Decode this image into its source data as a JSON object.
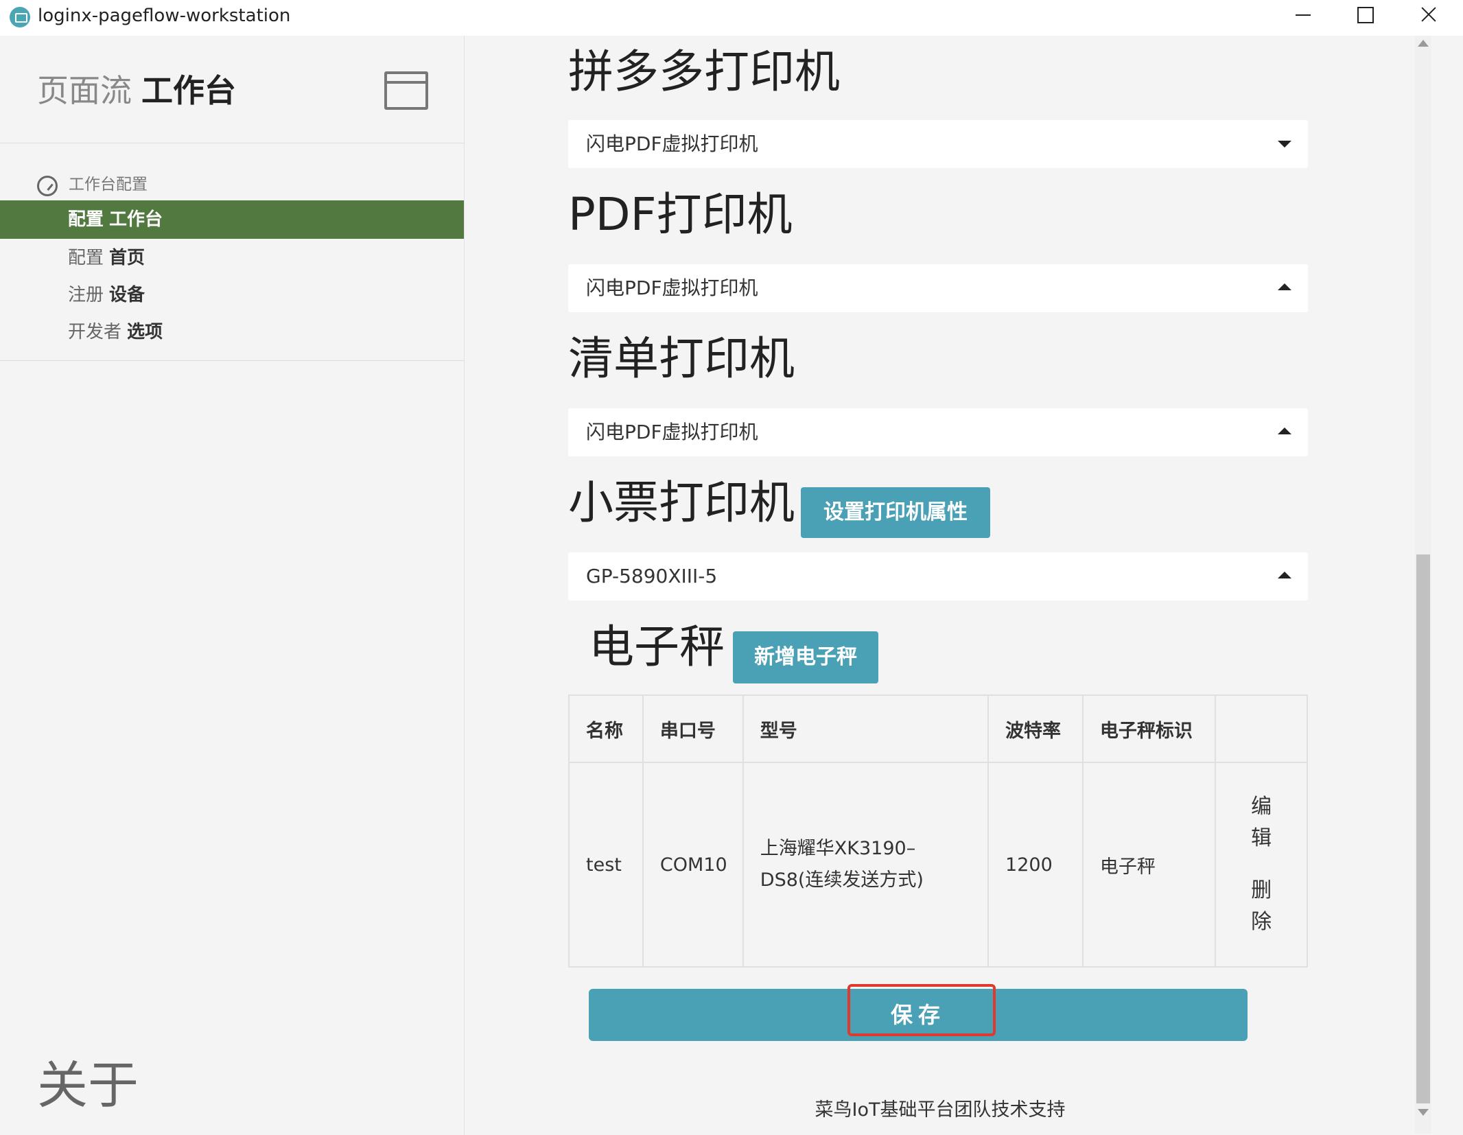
{
  "window": {
    "title": "loginx-pageflow-workstation"
  },
  "sidebar": {
    "brand_light": "页面流",
    "brand_bold": "工作台",
    "section_label": "工作台配置",
    "items": [
      {
        "prefix": "配置",
        "bold": "工作台",
        "active": true
      },
      {
        "prefix": "配置",
        "bold": "首页",
        "active": false
      },
      {
        "prefix": "注册",
        "bold": "设备",
        "active": false
      },
      {
        "prefix": "开发者",
        "bold": "选项",
        "active": false
      }
    ],
    "about": "关于"
  },
  "printers": [
    {
      "heading": "拼多多打印机",
      "value": "闪电PDF虚拟打印机",
      "caret": "down"
    },
    {
      "heading": "PDF打印机",
      "value": "闪电PDF虚拟打印机",
      "caret": "up"
    },
    {
      "heading": "清单打印机",
      "value": "闪电PDF虚拟打印机",
      "caret": "up"
    },
    {
      "heading": "小票打印机",
      "value": "GP-5890XIII-5",
      "caret": "up",
      "action_label": "设置打印机属性"
    }
  ],
  "scales": {
    "heading": "电子秤",
    "add_label": "新增电子秤",
    "columns": [
      "名称",
      "串口号",
      "型号",
      "波特率",
      "电子秤标识",
      ""
    ],
    "rows": [
      {
        "name": "test",
        "port": "COM10",
        "model": "上海耀华XK3190–DS8(连续发送方式)",
        "baud": "1200",
        "tag": "电子秤",
        "edit": "编辑",
        "delete": "删除"
      }
    ]
  },
  "save_label": "保存",
  "footer": "菜鸟IoT基础平台团队技术支持",
  "colors": {
    "sidebar_active": "#527a40",
    "accent": "#4aa0b4",
    "highlight": "#e03a2e"
  }
}
